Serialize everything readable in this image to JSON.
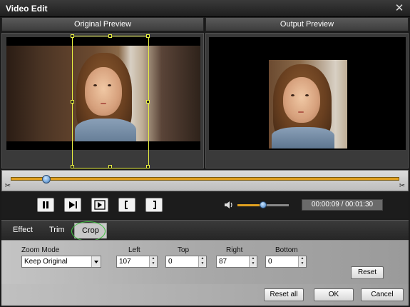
{
  "window": {
    "title": "Video Edit",
    "close_glyph": "✕"
  },
  "panels": {
    "original_label": "Original Preview",
    "output_label": "Output Preview"
  },
  "playback": {
    "progress_fraction": 0.09,
    "volume_fraction": 0.5,
    "time_display": "00:00:09 / 00:01:30",
    "buttons": [
      "pause-icon",
      "step-forward-icon",
      "frame-forward-icon",
      "mark-in-icon",
      "mark-out-icon"
    ]
  },
  "tabs": [
    {
      "label": "Effect"
    },
    {
      "label": "Trim"
    },
    {
      "label": "Crop"
    }
  ],
  "crop": {
    "zoom_mode_label": "Zoom Mode",
    "zoom_mode_value": "Keep Original",
    "left_label": "Left",
    "left_value": "107",
    "top_label": "Top",
    "top_value": "0",
    "right_label": "Right",
    "right_value": "87",
    "bottom_label": "Bottom",
    "bottom_value": "0",
    "reset_label": "Reset"
  },
  "footer": {
    "reset_all_label": "Reset all",
    "ok_label": "OK",
    "cancel_label": "Cancel"
  },
  "colors": {
    "accent_track": "#e0a020",
    "crop_frame": "#e8f040",
    "tab_highlight_ring": "#40c040"
  }
}
